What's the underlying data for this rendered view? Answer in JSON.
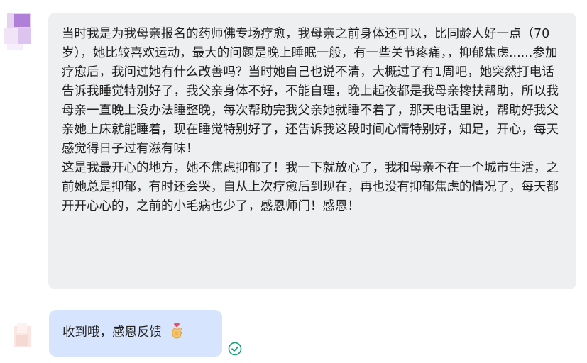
{
  "conversation": {
    "incoming_message": {
      "paragraphs": [
        "当时我是为我母亲报名的药师佛专场疗愈，我母亲之前身体还可以，比同龄人好一点（70岁），她比较喜欢运动，最大的问题是晚上睡眠一般，有一些关节疼痛，，抑郁焦虑......参加疗愈后，我问过她有什么改善吗？当时她自己也说不清，大概过了有1周吧，她突然打电话告诉我睡觉特别好了，我父亲身体不好，不能自理，晚上起夜都是我母亲搀扶帮助，所以我母亲一直晚上没办法睡整晚，每次帮助完我父亲她就睡不着了，那天电话里说，帮助好我父亲她上床就能睡着，现在睡觉特别好了，还告诉我这段时间心情特别好，知足，开心，每天感觉得日子过有滋有味！",
        "这是我最开心的地方，她不焦虑抑郁了！我一下就放心了，我和母亲不在一个城市生活，之前她总是抑郁，有时还会哭，自从上次疗愈后到现在，再也没有抑郁焦虑的情况了，每天都开开心心的，之前的小毛病也少了，感恩师门！感恩！"
      ]
    },
    "outgoing_message": {
      "text": "收到哦，感恩反馈",
      "emoji_icon": "finger-heart-emoji"
    },
    "colors": {
      "incoming_bubble": "#eeeff1",
      "outgoing_bubble": "#d6e4fd",
      "status_ok": "#16a07a"
    }
  }
}
